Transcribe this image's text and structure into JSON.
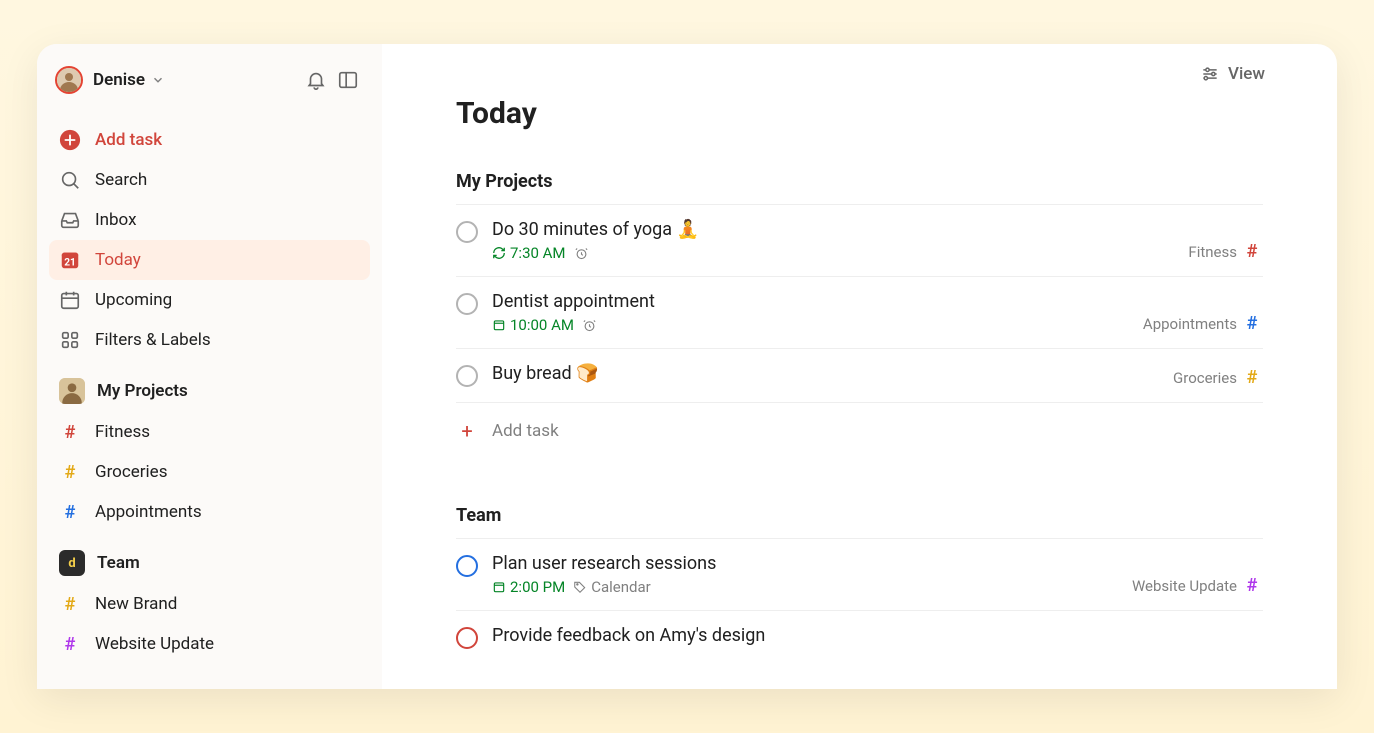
{
  "user": {
    "name": "Denise"
  },
  "sidebar": {
    "add_label": "Add task",
    "search_label": "Search",
    "inbox_label": "Inbox",
    "today_label": "Today",
    "today_date": "21",
    "upcoming_label": "Upcoming",
    "filters_label": "Filters & Labels"
  },
  "workspaces": {
    "personal": {
      "title": "My Projects",
      "items": [
        {
          "label": "Fitness",
          "color": "#d1453b"
        },
        {
          "label": "Groceries",
          "color": "#e3a917"
        },
        {
          "label": "Appointments",
          "color": "#246fe0"
        }
      ]
    },
    "team": {
      "title": "Team",
      "badge": "d",
      "items": [
        {
          "label": "New Brand",
          "color": "#e3a917"
        },
        {
          "label": "Website Update",
          "color": "#af38eb"
        }
      ]
    }
  },
  "view_label": "View",
  "page": {
    "title": "Today"
  },
  "sections": [
    {
      "title": "My Projects",
      "tasks": [
        {
          "title": "Do 30 minutes of yoga 🧘",
          "time": "7:30 AM",
          "time_icon": "recurring",
          "reminder": true,
          "project": "Fitness",
          "proj_color": "#d1453b",
          "priority": "normal"
        },
        {
          "title": "Dentist appointment",
          "time": "10:00 AM",
          "time_icon": "calendar",
          "reminder": true,
          "project": "Appointments",
          "proj_color": "#246fe0",
          "priority": "normal"
        },
        {
          "title": "Buy bread 🍞",
          "time": "",
          "time_icon": "",
          "reminder": false,
          "project": "Groceries",
          "proj_color": "#e3a917",
          "priority": "normal"
        }
      ],
      "add_label": "Add task"
    },
    {
      "title": "Team",
      "tasks": [
        {
          "title": "Plan user research sessions",
          "time": "2:00 PM",
          "time_icon": "calendar",
          "reminder": false,
          "extra_label": "Calendar",
          "project": "Website Update",
          "proj_color": "#af38eb",
          "priority": "p1"
        },
        {
          "title": "Provide feedback on Amy's design",
          "time": "",
          "time_icon": "",
          "reminder": false,
          "project": "",
          "proj_color": "#d1453b",
          "priority": "urgent"
        }
      ]
    }
  ]
}
